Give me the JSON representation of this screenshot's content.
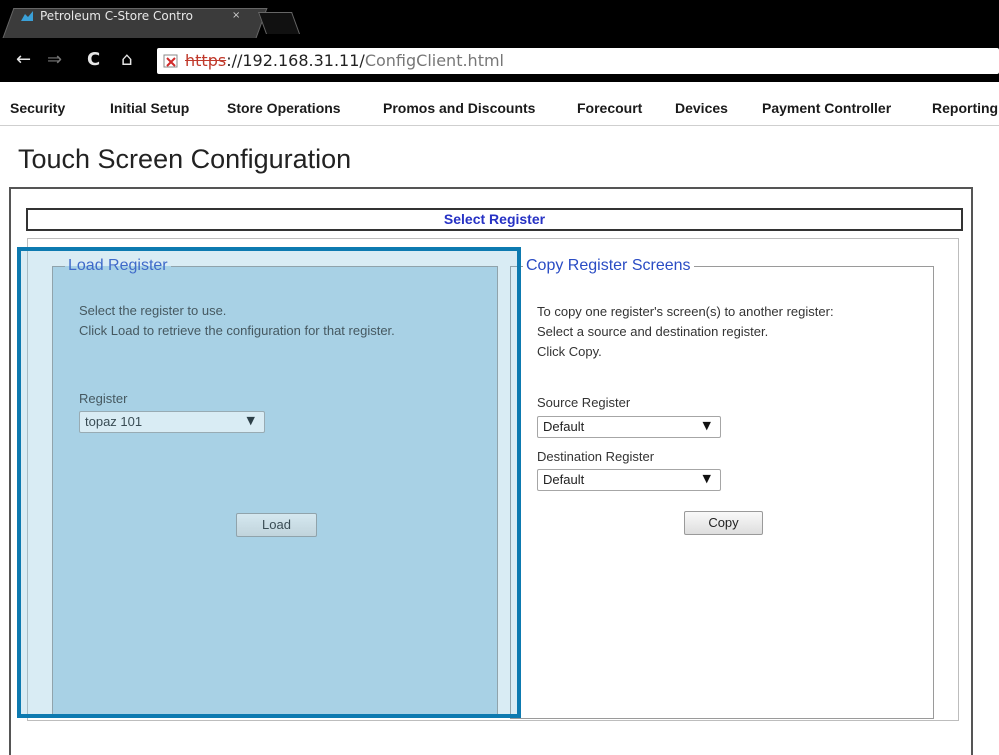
{
  "browser": {
    "tab_title": "Petroleum C-Store Contro",
    "tab_close": "×",
    "url_scheme": "https",
    "url_host": "://192.168.31.11/",
    "url_path": "ConfigClient.html",
    "nav": {
      "back": "←",
      "forward": "⇒",
      "reload": "C",
      "home": "⌂"
    }
  },
  "menu": [
    "Security",
    "Initial Setup",
    "Store Operations",
    "Promos and Discounts",
    "Forecourt",
    "Devices",
    "Payment Controller",
    "Reporting"
  ],
  "page_title": "Touch Screen Configuration",
  "select_register_header": "Select Register",
  "load_register": {
    "legend": "Load Register",
    "instruction_1": "Select the register to use.",
    "instruction_2": "Click Load to retrieve the configuration for that register.",
    "register_label": "Register",
    "register_value": "topaz 101",
    "load_button": "Load"
  },
  "copy_register": {
    "legend": "Copy Register Screens",
    "instruction_1": "To copy one register's screen(s) to another register:",
    "instruction_2": "Select a source and destination register.",
    "instruction_3": "Click Copy.",
    "source_label": "Source Register",
    "source_value": "Default",
    "destination_label": "Destination Register",
    "destination_value": "Default",
    "copy_button": "Copy"
  },
  "icons": {
    "dropdown_arrow": "▼"
  },
  "colors": {
    "highlight_border": "#0d7ab0",
    "load_panel_bg": "#bcdaea",
    "legend_text": "#2a4cc4",
    "header_text": "#2631c4"
  }
}
